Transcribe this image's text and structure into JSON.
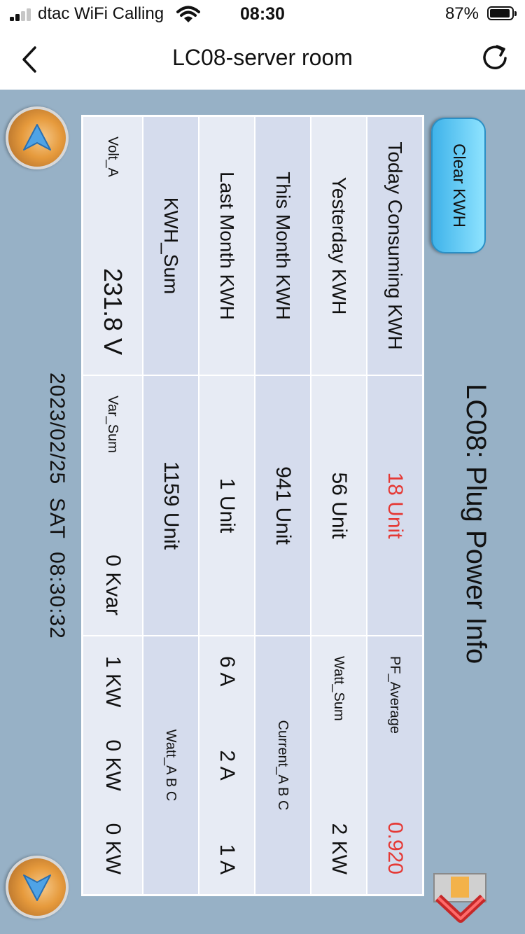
{
  "status_bar": {
    "carrier": "dtac WiFi Calling",
    "time": "08:30",
    "battery_percent": "87%"
  },
  "nav": {
    "title": "LC08-server room"
  },
  "page": {
    "title": "LC08: Plug Power Info",
    "clear_button": "Clear KWH",
    "datetime": "2023/02/25  SAT  08:30:32"
  },
  "table": {
    "today_label": "Today Consuming KWH",
    "today_value": "18 Unit",
    "pf_label": "PF_Average",
    "pf_value": "0.920",
    "yesterday_label": "Yesterday KWH",
    "yesterday_value": "56 Unit",
    "watt_sum_label": "Watt_Sum",
    "watt_sum_value": "2 KW",
    "this_month_label": "This Month KWH",
    "this_month_value": "941 Unit",
    "current_label": "Current_A B C",
    "last_month_label": "Last Month KWH",
    "last_month_value": "1 Unit",
    "current_values": [
      "6 A",
      "2 A",
      "1 A"
    ],
    "kwh_sum_label": "KWH_Sum",
    "kwh_sum_value": "1159 Unit",
    "watt_abc_label": "Watt_A B C",
    "volt_label": "Volt_A",
    "volt_value": "231.8 V",
    "var_label": "Var_Sum",
    "var_value": "0 Kvar",
    "watt_values": [
      "1 KW",
      "0 KW",
      "0 KW"
    ]
  },
  "colors": {
    "highlight": "#e53935",
    "background": "#97b1c6",
    "row_dark": "#d5dced",
    "row_light": "#e7ebf4",
    "button": "#3fb3ea"
  },
  "icons": [
    "back-chevron-icon",
    "refresh-icon",
    "wifi-icon",
    "exit-icon",
    "arrow-up-icon",
    "arrow-down-icon"
  ]
}
